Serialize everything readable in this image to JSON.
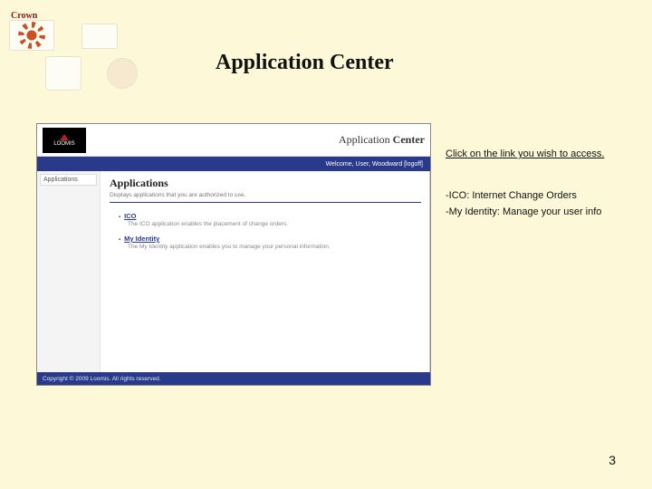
{
  "decor": {
    "crown": "Crown"
  },
  "slide": {
    "title": "Application Center"
  },
  "screenshot": {
    "logo_text": "LOOMIS",
    "header_label_prefix": "Application ",
    "header_label_bold": "Center",
    "welcome": "Welcome, User, Woodward [logoff]",
    "sidebar": {
      "item0": "Applications"
    },
    "main": {
      "heading": "Applications",
      "subheading": "Displays applications that you are authorized to use.",
      "items": [
        {
          "label": "ICO",
          "desc": "The ICO application enables the placement of change orders."
        },
        {
          "label": "My Identity",
          "desc": "The My Identity application enables you to manage your personal information."
        }
      ]
    },
    "footer": "Copyright © 2009 Loomis. All rights reserved."
  },
  "annotations": {
    "line1": "Click on the link you wish to access.",
    "line2": "-ICO: Internet Change Orders",
    "line3": "-My Identity: Manage your user info"
  },
  "page_number": "3"
}
